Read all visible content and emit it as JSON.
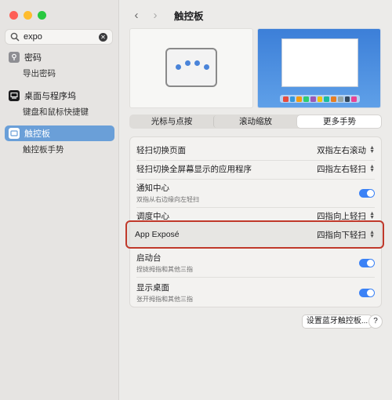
{
  "sidebar": {
    "search": {
      "value": "expo",
      "placeholder": "搜索"
    },
    "items": [
      {
        "label": "密码",
        "sub": "导出密码",
        "icon": "key-icon"
      },
      {
        "label": "桌面与程序坞",
        "sub": "键盘和鼠标快捷键",
        "icon": "dock-icon"
      },
      {
        "label": "触控板",
        "sub": "触控板手势",
        "icon": "trackpad-icon",
        "active": true
      }
    ]
  },
  "header": {
    "title": "触控板"
  },
  "tabs": [
    {
      "label": "光标与点按"
    },
    {
      "label": "滚动缩放"
    },
    {
      "label": "更多手势",
      "selected": true
    }
  ],
  "settings": [
    {
      "label": "轻扫切换页面",
      "value": "双指左右滚动"
    },
    {
      "label": "轻扫切换全屏幕显示的应用程序",
      "value": "四指左右轻扫"
    },
    {
      "label": "通知中心",
      "sub": "双指从右边缘向左轻扫",
      "toggle": true
    },
    {
      "label": "调度中心",
      "value": "四指向上轻扫"
    },
    {
      "label": "App Exposé",
      "value": "四指向下轻扫"
    },
    {
      "label": "启动台",
      "sub": "捏拢拇指和其他三指",
      "toggle": true
    },
    {
      "label": "显示桌面",
      "sub": "张开拇指和其他三指",
      "toggle": true
    }
  ],
  "footer": {
    "bluetooth_button": "设置蓝牙触控板...",
    "help_button": "?"
  },
  "colors": {
    "accent": "#3b82f6",
    "highlight_border": "#c0392b",
    "sidebar_active": "#6a9fd8"
  }
}
